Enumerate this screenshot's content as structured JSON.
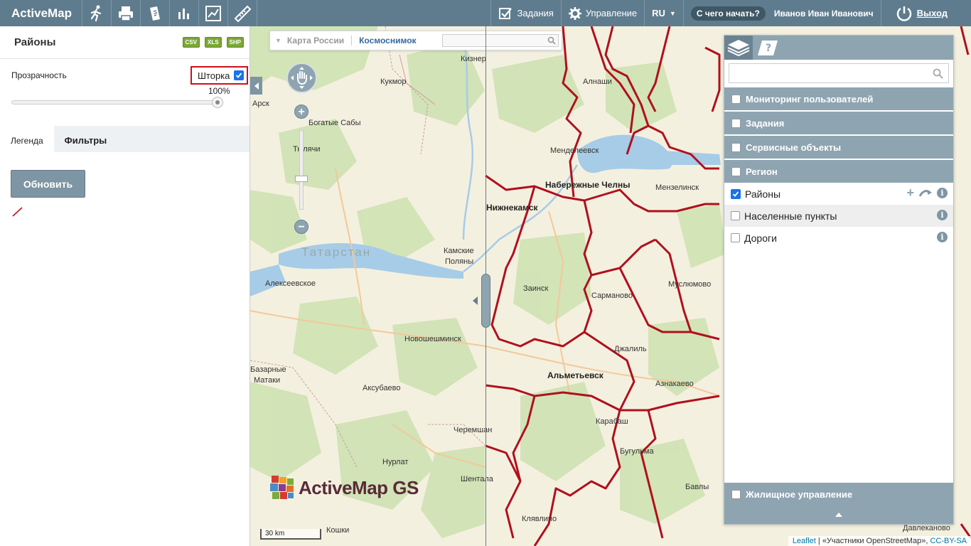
{
  "topbar": {
    "brand": "ActiveMap",
    "tools": [
      "run-icon",
      "print-icon",
      "document-icon",
      "bar-chart-icon",
      "line-chart-icon",
      "measure-icon"
    ],
    "tasks_label": "Задания",
    "manage_label": "Управление",
    "lang": "RU",
    "help_label": "С чего начать?",
    "user_name": "Иванов Иван Иванович",
    "logout_label": "Выход"
  },
  "leftpanel": {
    "title": "Районы",
    "exports": [
      "CSV",
      "XLS",
      "SHP"
    ],
    "opacity_label": "Прозрачность",
    "swipe_label": "Шторка",
    "opacity_value": "100%",
    "tabs": [
      "Легенда",
      "Фильтры"
    ],
    "refresh_label": "Обновить",
    "legend_color": "#c0101a"
  },
  "map": {
    "basemaps": [
      "Карта России",
      "Космоснимок"
    ],
    "labels": {
      "kizner": "Кизнер",
      "kukmor": "Кукмор",
      "arsk": "Арск",
      "bogatye_saby": "Богатые Сабы",
      "tyulyachi": "Тюлячи",
      "tatarstan": "Татарстан",
      "kamskie_polyany_1": "Камские",
      "kamskie_polyany_2": "Поляны",
      "alekseevskoe": "Алексеевское",
      "novosheshminsk": "Новошешминск",
      "bazarnye_1": "Базарные",
      "bazarnye_2": "Матаки",
      "aksubaevo": "Аксубаево",
      "cheremshan": "Черемшан",
      "nurlat": "Нурлат",
      "shentala": "Шентала",
      "koshki": "Кошки",
      "alnashi": "Алнаши",
      "mendeleevsk": "Менделеевск",
      "naberezhnye": "Набережные Челны",
      "nizhnekamsk": "Нижнекамск",
      "menzelinsk": "Мензелинск",
      "zainsk": "Заинск",
      "sarmanovo": "Сарманово",
      "muslyumovo": "Муслюмово",
      "dzhalil": "Джалиль",
      "almetyevsk": "Альметьевск",
      "aznakaevo": "Азнакаево",
      "karabash": "Карабаш",
      "bugulma": "Бугульма",
      "bavly": "Бавлы",
      "klyavlino": "Клявлино",
      "davlekanovo": "Давлеканово"
    },
    "logo": "ActiveMap GS",
    "scale": "30 km",
    "attribution_leaflet": "Leaflet",
    "attribution_osm": "| «Участники OpenStreetMap»,",
    "attribution_license": "CC-BY-SA"
  },
  "layers": {
    "groups": [
      "Мониторинг пользователей",
      "Задания",
      "Сервисные объекты",
      "Регион"
    ],
    "region_layers": [
      {
        "name": "Районы",
        "checked": true
      },
      {
        "name": "Населенные пункты",
        "checked": false
      },
      {
        "name": "Дороги",
        "checked": false
      }
    ],
    "bottom_group": "Жилищное управление"
  }
}
